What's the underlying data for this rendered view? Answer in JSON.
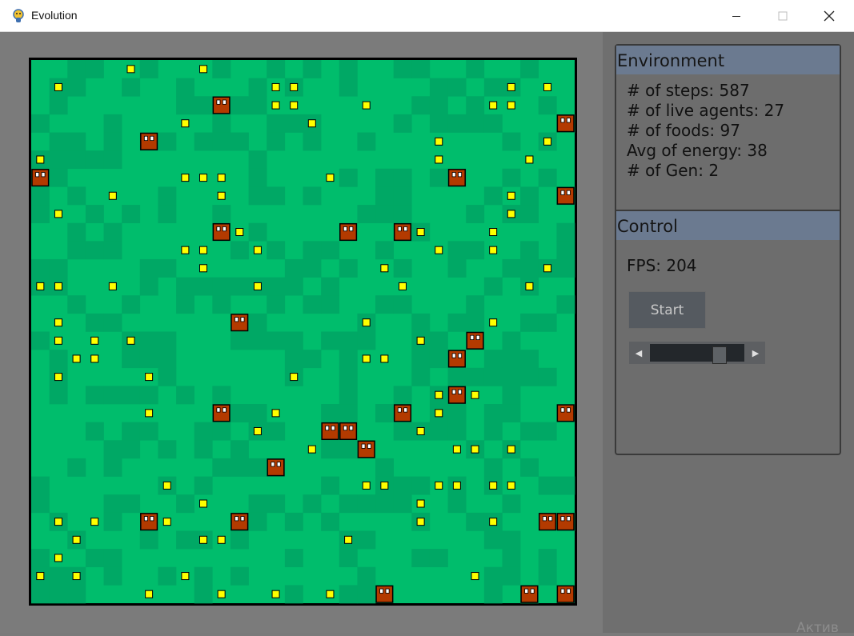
{
  "window": {
    "title": "Evolution",
    "minimize_icon": "minimize-icon",
    "maximize_icon": "maximize-icon",
    "close_icon": "close-icon"
  },
  "colors": {
    "grass": "#00bd6c",
    "grass_dark": "#00a865",
    "food": "#ffff00",
    "agent": "#b33a00",
    "board_border": "#000000",
    "panel_header": "#6b7a90"
  },
  "world": {
    "grid": 30,
    "foods": [
      [
        5,
        0
      ],
      [
        9,
        0
      ],
      [
        1,
        1
      ],
      [
        13,
        1
      ],
      [
        14,
        1
      ],
      [
        26,
        1
      ],
      [
        28,
        1
      ],
      [
        13,
        2
      ],
      [
        14,
        2
      ],
      [
        18,
        2
      ],
      [
        25,
        2
      ],
      [
        26,
        2
      ],
      [
        8,
        3
      ],
      [
        15,
        3
      ],
      [
        22,
        4
      ],
      [
        28,
        4
      ],
      [
        0,
        5
      ],
      [
        22,
        5
      ],
      [
        27,
        5
      ],
      [
        8,
        6
      ],
      [
        9,
        6
      ],
      [
        10,
        6
      ],
      [
        16,
        6
      ],
      [
        4,
        7
      ],
      [
        10,
        7
      ],
      [
        26,
        7
      ],
      [
        1,
        8
      ],
      [
        26,
        8
      ],
      [
        11,
        9
      ],
      [
        21,
        9
      ],
      [
        25,
        9
      ],
      [
        8,
        10
      ],
      [
        9,
        10
      ],
      [
        12,
        10
      ],
      [
        22,
        10
      ],
      [
        25,
        10
      ],
      [
        9,
        11
      ],
      [
        19,
        11
      ],
      [
        28,
        11
      ],
      [
        0,
        12
      ],
      [
        1,
        12
      ],
      [
        4,
        12
      ],
      [
        12,
        12
      ],
      [
        20,
        12
      ],
      [
        27,
        12
      ],
      [
        1,
        14
      ],
      [
        18,
        14
      ],
      [
        25,
        14
      ],
      [
        1,
        15
      ],
      [
        3,
        15
      ],
      [
        5,
        15
      ],
      [
        21,
        15
      ],
      [
        2,
        16
      ],
      [
        3,
        16
      ],
      [
        18,
        16
      ],
      [
        19,
        16
      ],
      [
        1,
        17
      ],
      [
        6,
        17
      ],
      [
        14,
        17
      ],
      [
        22,
        18
      ],
      [
        24,
        18
      ],
      [
        6,
        19
      ],
      [
        13,
        19
      ],
      [
        22,
        19
      ],
      [
        12,
        20
      ],
      [
        21,
        20
      ],
      [
        15,
        21
      ],
      [
        23,
        21
      ],
      [
        24,
        21
      ],
      [
        26,
        21
      ],
      [
        7,
        23
      ],
      [
        18,
        23
      ],
      [
        19,
        23
      ],
      [
        22,
        23
      ],
      [
        23,
        23
      ],
      [
        25,
        23
      ],
      [
        26,
        23
      ],
      [
        9,
        24
      ],
      [
        21,
        24
      ],
      [
        1,
        25
      ],
      [
        3,
        25
      ],
      [
        7,
        25
      ],
      [
        21,
        25
      ],
      [
        25,
        25
      ],
      [
        2,
        26
      ],
      [
        9,
        26
      ],
      [
        10,
        26
      ],
      [
        17,
        26
      ],
      [
        1,
        27
      ],
      [
        0,
        28
      ],
      [
        2,
        28
      ],
      [
        8,
        28
      ],
      [
        24,
        28
      ],
      [
        6,
        29
      ],
      [
        10,
        29
      ],
      [
        13,
        29
      ],
      [
        16,
        29
      ]
    ],
    "agents": [
      [
        10,
        2
      ],
      [
        29,
        3
      ],
      [
        6,
        4
      ],
      [
        0,
        6
      ],
      [
        23,
        6
      ],
      [
        29,
        7
      ],
      [
        10,
        9
      ],
      [
        17,
        9
      ],
      [
        20,
        9
      ],
      [
        11,
        14
      ],
      [
        24,
        15
      ],
      [
        23,
        16
      ],
      [
        23,
        18
      ],
      [
        10,
        19
      ],
      [
        20,
        19
      ],
      [
        29,
        19
      ],
      [
        16,
        20
      ],
      [
        17,
        20
      ],
      [
        18,
        21
      ],
      [
        13,
        22
      ],
      [
        6,
        25
      ],
      [
        11,
        25
      ],
      [
        28,
        25
      ],
      [
        29,
        25
      ],
      [
        19,
        29
      ],
      [
        27,
        29
      ],
      [
        29,
        29
      ]
    ]
  },
  "environment": {
    "heading": "Environment",
    "steps": "# of steps: 587",
    "agents": "# of live agents: 27",
    "foods": "# of foods: 97",
    "energy": "Avg of energy: 38",
    "gen": "# of Gen: 2"
  },
  "control": {
    "heading": "Control",
    "fps": "FPS: 204",
    "start_label": "Start",
    "slider_value": 0.78,
    "left_arrow": "◀",
    "right_arrow": "▶"
  },
  "watermark": "Актив"
}
